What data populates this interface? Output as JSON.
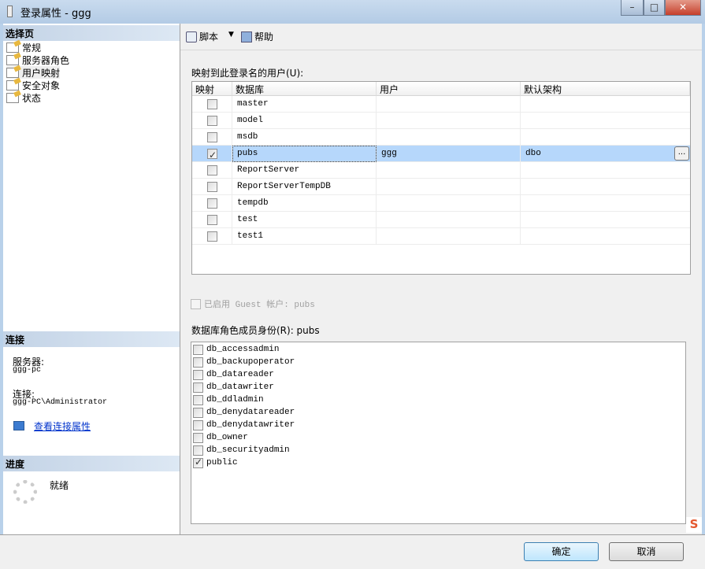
{
  "window": {
    "title": "登录属性 - ggg",
    "minimize": "–",
    "maximize": "□",
    "close": "✕"
  },
  "left": {
    "select_page_header": "选择页",
    "pages": [
      "常规",
      "服务器角色",
      "用户映射",
      "安全对象",
      "状态"
    ],
    "connection_header": "连接",
    "server_label": "服务器:",
    "server_value": "ggg-pc",
    "connection_label": "连接:",
    "connection_value": "ggg-PC\\Administrator",
    "view_connection_link": "查看连接属性",
    "progress_header": "进度",
    "progress_status": "就绪"
  },
  "toolbar": {
    "script": "脚本",
    "help": "帮助"
  },
  "mapping": {
    "label": "映射到此登录名的用户(U):",
    "columns": [
      "映射",
      "数据库",
      "用户",
      "默认架构"
    ],
    "rows": [
      {
        "mapped": false,
        "database": "master",
        "user": "",
        "schema": ""
      },
      {
        "mapped": false,
        "database": "model",
        "user": "",
        "schema": ""
      },
      {
        "mapped": false,
        "database": "msdb",
        "user": "",
        "schema": ""
      },
      {
        "mapped": true,
        "database": "pubs",
        "user": "ggg",
        "schema": "dbo",
        "selected": true
      },
      {
        "mapped": false,
        "database": "ReportServer",
        "user": "",
        "schema": ""
      },
      {
        "mapped": false,
        "database": "ReportServerTempDB",
        "user": "",
        "schema": ""
      },
      {
        "mapped": false,
        "database": "tempdb",
        "user": "",
        "schema": ""
      },
      {
        "mapped": false,
        "database": "test",
        "user": "",
        "schema": ""
      },
      {
        "mapped": false,
        "database": "test1",
        "user": "",
        "schema": ""
      }
    ],
    "ellipsis": "..."
  },
  "guest": {
    "label": "已启用 Guest 帐户: pubs",
    "checked": false
  },
  "roles": {
    "label": "数据库角色成员身份(R): pubs",
    "items": [
      {
        "name": "db_accessadmin",
        "checked": false
      },
      {
        "name": "db_backupoperator",
        "checked": false
      },
      {
        "name": "db_datareader",
        "checked": false
      },
      {
        "name": "db_datawriter",
        "checked": false
      },
      {
        "name": "db_ddladmin",
        "checked": false
      },
      {
        "name": "db_denydatareader",
        "checked": false
      },
      {
        "name": "db_denydatawriter",
        "checked": false
      },
      {
        "name": "db_owner",
        "checked": false
      },
      {
        "name": "db_securityadmin",
        "checked": false
      },
      {
        "name": "public",
        "checked": true
      }
    ]
  },
  "buttons": {
    "ok": "确定",
    "cancel": "取消"
  },
  "ime": {
    "label": "S"
  }
}
